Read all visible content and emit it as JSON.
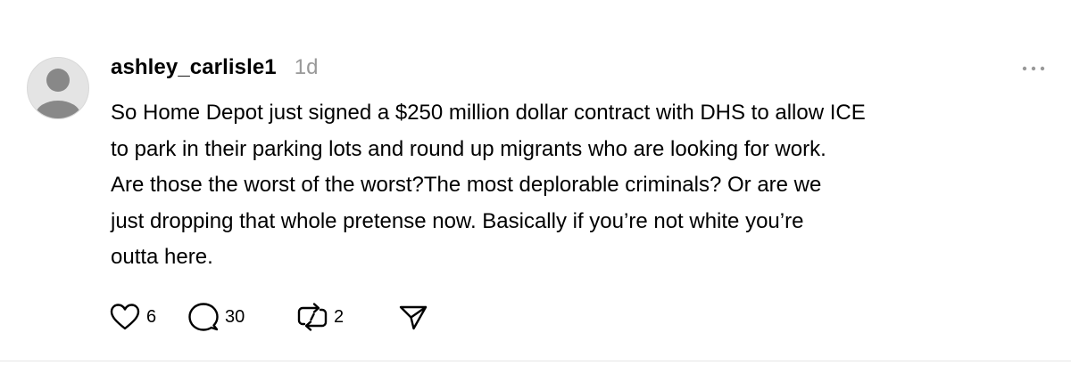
{
  "post": {
    "author": {
      "username": "ashley_carlisle1",
      "avatar_icon": "default-avatar-icon"
    },
    "timestamp": "1d",
    "more_icon": "more-options-icon",
    "text_lines": [
      "So Home Depot just signed a $250 million dollar contract with DHS to allow ICE",
      "to park in their parking lots and round up migrants who are looking for work.",
      "Are those the worst of the worst?The most deplorable criminals? Or are we",
      "just dropping that whole pretense now. Basically if you’re not white you’re",
      "outta here."
    ],
    "actions": {
      "like": {
        "icon": "heart-icon",
        "count": "6"
      },
      "reply": {
        "icon": "comment-icon",
        "count": "30"
      },
      "repost": {
        "icon": "repost-icon",
        "count": "2"
      },
      "share": {
        "icon": "send-icon"
      }
    }
  },
  "colors": {
    "text": "#000000",
    "muted": "#999999",
    "avatar_bg": "#e4e4e4",
    "avatar_figure": "#888888",
    "divider": "#e6e6e6"
  }
}
